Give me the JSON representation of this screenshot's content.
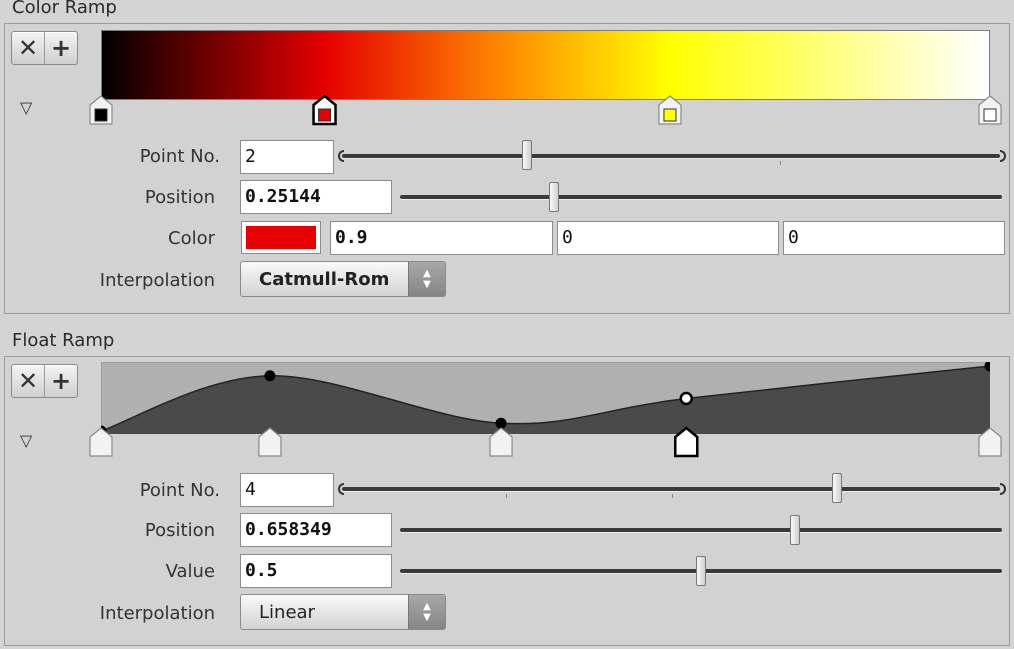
{
  "color_ramp": {
    "title": "Color Ramp",
    "remove_btn": "✕",
    "add_btn": "+",
    "gradient_stops": [
      {
        "pos": 0.0,
        "color": "#000000"
      },
      {
        "pos": 0.25144,
        "color": "#e60000"
      },
      {
        "pos": 0.45,
        "color": "#ff8800"
      },
      {
        "pos": 0.64,
        "color": "#ffff00"
      },
      {
        "pos": 1.0,
        "color": "#ffffff"
      }
    ],
    "markers": [
      {
        "pos": 0.0,
        "fill": "#000000",
        "selected": false
      },
      {
        "pos": 0.25144,
        "fill": "#e60000",
        "selected": true
      },
      {
        "pos": 0.64,
        "fill": "#ffff00",
        "selected": false
      },
      {
        "pos": 1.0,
        "fill": "#ffffff",
        "selected": false
      }
    ],
    "point_no_label": "Point No.",
    "point_no": "2",
    "point_no_slider": 0.28,
    "position_label": "Position",
    "position": "0.25144",
    "position_slider": 0.25144,
    "color_label": "Color",
    "swatch_color": "#e60000",
    "color_r": "0.9",
    "color_g": "0",
    "color_b": "0",
    "interpolation_label": "Interpolation",
    "interpolation": "Catmull-Rom"
  },
  "float_ramp": {
    "title": "Float Ramp",
    "remove_btn": "✕",
    "add_btn": "+",
    "points": [
      {
        "pos": 0.0,
        "value": 0.0,
        "selected": false
      },
      {
        "pos": 0.19,
        "value": 0.85,
        "selected": false
      },
      {
        "pos": 0.45,
        "value": 0.12,
        "selected": false
      },
      {
        "pos": 0.658349,
        "value": 0.5,
        "selected": true
      },
      {
        "pos": 1.0,
        "value": 1.0,
        "selected": false
      }
    ],
    "point_no_label": "Point No.",
    "point_no": "4",
    "point_no_slider": 0.75,
    "position_label": "Position",
    "position": "0.658349",
    "position_slider": 0.658349,
    "value_label": "Value",
    "value": "0.5",
    "value_slider": 0.5,
    "interpolation_label": "Interpolation",
    "interpolation": "Linear"
  }
}
